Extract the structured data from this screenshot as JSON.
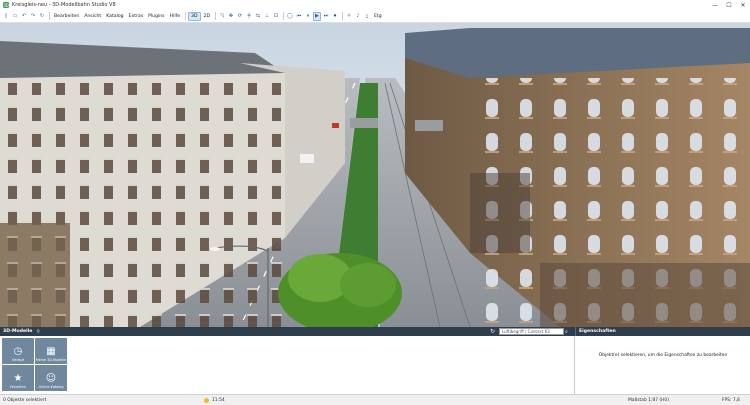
{
  "window": {
    "title": "Kreisgleis-neu - 3D-Modellbahn Studio V8",
    "app_icon": "3D"
  },
  "toolbar": {
    "buttons": [
      {
        "name": "new-icon",
        "glyph": "▯"
      },
      {
        "name": "open-icon",
        "glyph": "▭"
      },
      {
        "name": "undo-icon",
        "glyph": "↶"
      },
      {
        "name": "redo-icon",
        "glyph": "↷"
      },
      {
        "name": "reload-icon",
        "glyph": "↻"
      }
    ],
    "menu": [
      "Bearbeiten",
      "Ansicht",
      "Katalog",
      "Extras",
      "Plugins",
      "Hilfe"
    ],
    "view_3d": "3D",
    "view_2d": "2D",
    "tools": [
      {
        "name": "select-icon",
        "glyph": "◹"
      },
      {
        "name": "move-icon",
        "glyph": "✥"
      },
      {
        "name": "rotate-icon",
        "glyph": "⟳"
      },
      {
        "name": "track-icon",
        "glyph": "╪"
      },
      {
        "name": "connect-icon",
        "glyph": "⇆"
      },
      {
        "name": "crane-icon",
        "glyph": "⊥"
      },
      {
        "name": "lock-icon",
        "glyph": "⊡"
      }
    ],
    "playback": [
      {
        "name": "circle-icon",
        "glyph": "◯"
      },
      {
        "name": "step-back-icon",
        "glyph": "⏮"
      },
      {
        "name": "pause-icon",
        "glyph": "⏸"
      },
      {
        "name": "play-icon",
        "glyph": "▶"
      },
      {
        "name": "fast-forward-icon",
        "glyph": "⏭"
      },
      {
        "name": "record-icon",
        "glyph": "⏺"
      }
    ],
    "extra": [
      {
        "name": "weather-icon",
        "glyph": "☼"
      },
      {
        "name": "sound-icon",
        "glyph": "♪"
      },
      {
        "name": "download-icon",
        "glyph": "⤓"
      }
    ],
    "speed": "Etg"
  },
  "models_panel": {
    "title": "3D-Modelle",
    "pin_icon": "⚲",
    "search_value": "Luftlbegriff / Context 63",
    "tiles": [
      {
        "name": "tile-verlauf",
        "label": "Verlauf",
        "glyph": "◷"
      },
      {
        "name": "tile-meine-3d-modelle",
        "label": "Meine 3D-Modelle",
        "glyph": "▦"
      },
      {
        "name": "tile-favoriten",
        "label": "Favoriten",
        "glyph": "★"
      },
      {
        "name": "tile-online-katalog",
        "label": "Online-Katalog",
        "glyph": "☺"
      }
    ]
  },
  "properties_panel": {
    "title": "Eigenschaften",
    "message": "Objekt(e) selektieren, um die Eigenschaften zu bearbeiten"
  },
  "status": {
    "selection": "0 Objekte selektiert",
    "time": "11:54",
    "scale": "Maßstab 1:87 (H0)",
    "fps": "FPS: 7,8"
  },
  "colors": {
    "panel_header": "#2f3e4c",
    "tile": "#6f889e",
    "accent": "#2b5e8f"
  }
}
